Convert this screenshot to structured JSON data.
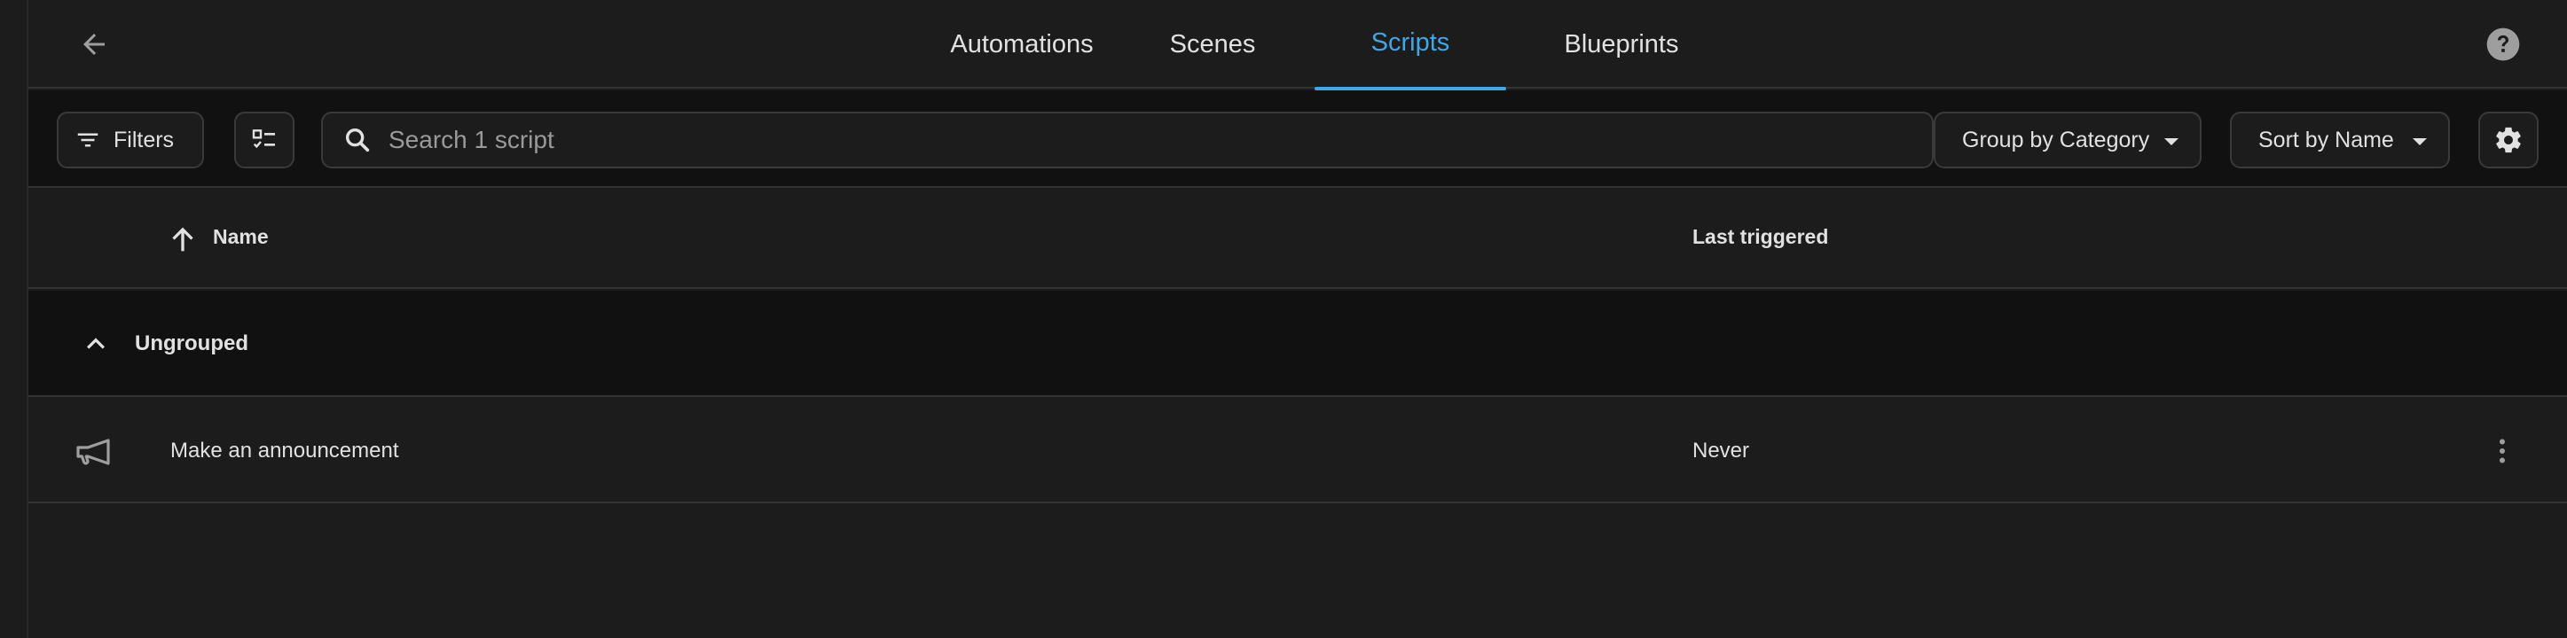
{
  "header": {
    "tabs": [
      {
        "label": "Automations",
        "active": false
      },
      {
        "label": "Scenes",
        "active": false
      },
      {
        "label": "Scripts",
        "active": true
      },
      {
        "label": "Blueprints",
        "active": false
      }
    ],
    "icons": {
      "back": "arrow-left-icon",
      "help": "help-circle-icon"
    }
  },
  "toolbar": {
    "filters_label": "Filters",
    "search_placeholder": "Search 1 script",
    "search_value": "",
    "group_by_label": "Group by Category",
    "sort_by_label": "Sort by Name",
    "icons": {
      "filters": "filter-icon",
      "select": "checklist-icon",
      "search": "search-icon",
      "settings": "gear-icon"
    }
  },
  "table": {
    "columns": {
      "name": "Name",
      "last_triggered": "Last triggered"
    },
    "sort": "ascending",
    "group": {
      "label": "Ungrouped",
      "expanded": true
    },
    "rows": [
      {
        "name": "Make an announcement",
        "last_triggered": "Never",
        "icon": "megaphone-icon"
      }
    ]
  },
  "colors": {
    "accent": "#3fa7e6",
    "background": "#111111",
    "surface": "#1c1c1c",
    "text": "#e1e1e1"
  }
}
